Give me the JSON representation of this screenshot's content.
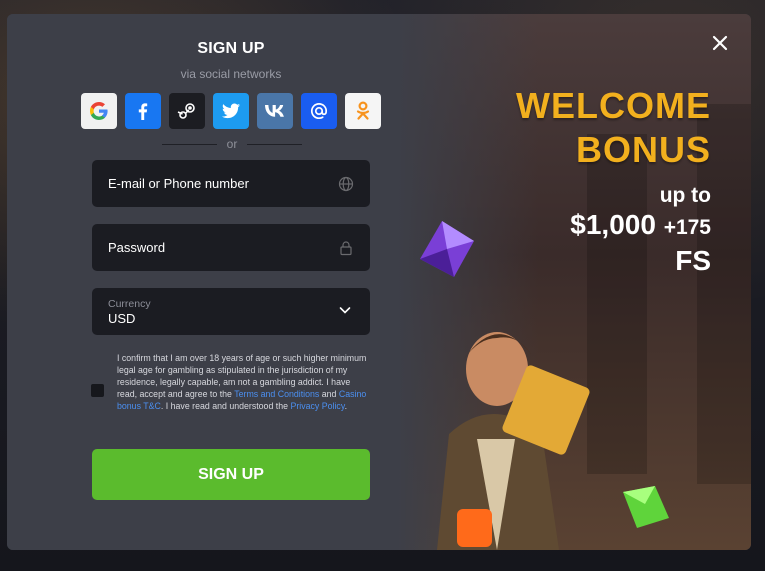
{
  "form": {
    "title": "SIGN UP",
    "subtitle": "via social networks",
    "social_networks": [
      {
        "icon": "google-icon",
        "bg": "#f1f1f1"
      },
      {
        "icon": "facebook-icon",
        "bg": "#1877f2"
      },
      {
        "icon": "steam-icon",
        "bg": "#1c1d22"
      },
      {
        "icon": "twitter-icon",
        "bg": "#1d9bf0"
      },
      {
        "icon": "vk-icon",
        "bg": "#4a76a8"
      },
      {
        "icon": "mailru-icon",
        "bg": "#1a5df0"
      },
      {
        "icon": "odnoklassniki-icon",
        "bg": "#f5f5f5"
      }
    ],
    "or_label": "or",
    "email_label": "E-mail or Phone number",
    "email_icon": "globe-icon",
    "password_label": "Password",
    "password_icon": "lock-icon",
    "currency_caption": "Currency",
    "currency_value": "USD",
    "consent": {
      "checked": false,
      "text_1": "I confirm that I am over 18 years of age or such higher minimum legal age for gambling as stipulated in the jurisdiction of my residence, legally capable, am not a gambling addict. I have read, accept and agree to the ",
      "link_1": "Terms and Conditions",
      "text_2": " and ",
      "link_2": "Casino bonus T&C",
      "text_3": ". I have read and understood the ",
      "link_3": "Privacy Policy",
      "text_4": "."
    },
    "submit_label": "SIGN UP"
  },
  "promo": {
    "line_1": "WELCOME",
    "line_2": "BONUS",
    "line_3": "up to",
    "amount": "$1,000",
    "extra": "+175",
    "fs": "FS",
    "accent_color": "#f2b01e"
  },
  "colors": {
    "primary_button": "#5bbb2d",
    "link": "#4b8ff0",
    "modal_bg": "#3d3f48",
    "input_bg": "#1b1c22"
  }
}
